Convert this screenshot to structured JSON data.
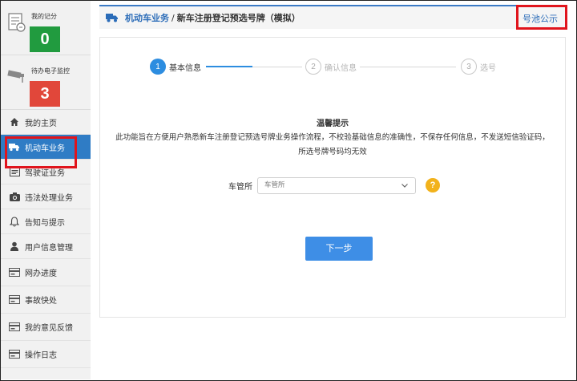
{
  "sidebar": {
    "score_label": "我的记分",
    "score_value": "0",
    "monitor_label": "待办电子监控",
    "monitor_value": "3",
    "items": [
      {
        "label": "我的主页"
      },
      {
        "label": "机动车业务"
      },
      {
        "label": "驾驶证业务"
      },
      {
        "label": "违法处理业务"
      },
      {
        "label": "告知与提示"
      },
      {
        "label": "用户信息管理"
      },
      {
        "label": "网办进度"
      },
      {
        "label": "事故快处"
      },
      {
        "label": "我的意见反馈"
      },
      {
        "label": "操作日志"
      }
    ]
  },
  "header": {
    "breadcrumb_main": "机动车业务",
    "separator": "/",
    "breadcrumb_sub": "新车注册登记预选号牌（模拟）",
    "pool_link": "号池公示"
  },
  "steps": [
    {
      "num": "1",
      "label": "基本信息"
    },
    {
      "num": "2",
      "label": "确认信息"
    },
    {
      "num": "3",
      "label": "选号"
    }
  ],
  "tip": {
    "title": "温馨提示",
    "body": "此功能旨在方便用户熟悉新车注册登记预选号牌业务操作流程，不校验基础信息的准确性，不保存任何信息，不发送短信验证码，所选号牌号码均无效"
  },
  "form": {
    "label": "车管所",
    "select_value": "车管所",
    "help": "?"
  },
  "next_button": "下一步",
  "colors": {
    "accent": "#2f7cc5",
    "score_badge": "#219b3f",
    "monitor_badge": "#e1473a",
    "highlight": "#e0141c"
  }
}
